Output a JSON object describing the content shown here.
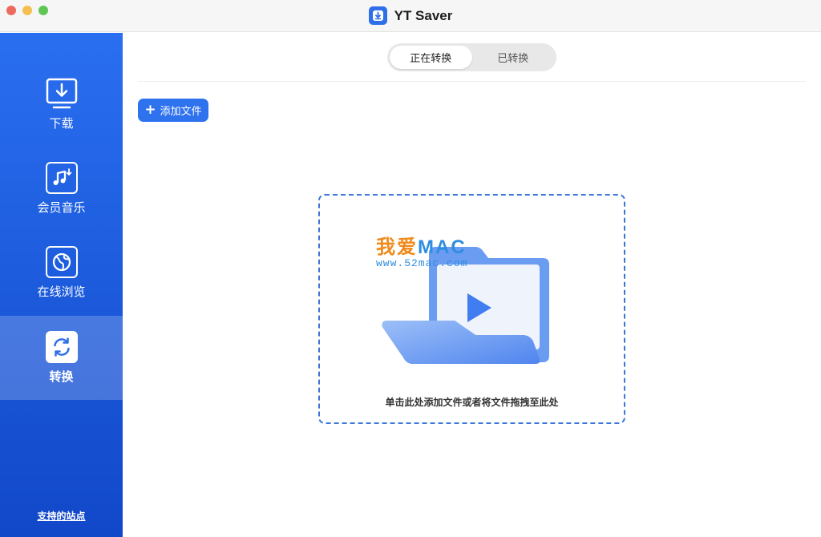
{
  "window": {
    "title": "YT Saver"
  },
  "sidebar": {
    "items": [
      {
        "label": "下载",
        "icon": "download-icon",
        "active": false
      },
      {
        "label": "会员音乐",
        "icon": "music-icon",
        "active": false
      },
      {
        "label": "在线浏览",
        "icon": "browser-icon",
        "active": false
      },
      {
        "label": "转换",
        "icon": "convert-icon",
        "active": true
      }
    ],
    "supported_sites": "支持的站点"
  },
  "tabs": [
    {
      "label": "正在转换",
      "active": true
    },
    {
      "label": "已转换",
      "active": false
    }
  ],
  "toolbar": {
    "add_file": "添加文件"
  },
  "dropzone": {
    "hint": "单击此处添加文件或者将文件拖拽至此处",
    "watermark_cn": "我爱",
    "watermark_en": "MAC",
    "watermark_url": "www.52mac.com"
  },
  "colors": {
    "accent": "#2f72ee",
    "sidebar_top": "#2a6ff0",
    "sidebar_bottom": "#1148c9",
    "dropzone_border": "#3b76d8"
  }
}
